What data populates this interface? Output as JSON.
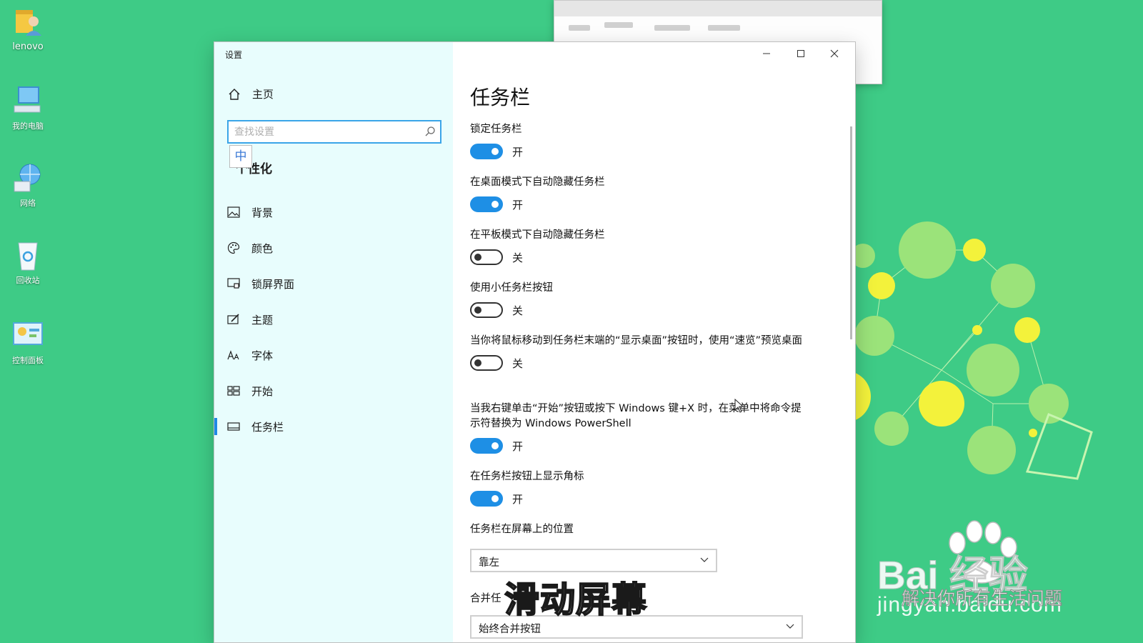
{
  "desktop": {
    "icons": [
      {
        "label": "lenovo",
        "icon": "user-folder-icon"
      },
      {
        "label": "我的电脑",
        "icon": "computer-icon"
      },
      {
        "label": "网络",
        "icon": "network-globe-icon"
      },
      {
        "label": "回收站",
        "icon": "recycle-bin-icon"
      },
      {
        "label": "控制面板",
        "icon": "control-panel-icon"
      }
    ],
    "background_color": "#3ecb86"
  },
  "window": {
    "title": "设置",
    "controls": {
      "minimize": "minimize-icon",
      "maximize": "maximize-icon",
      "close": "close-icon"
    }
  },
  "nav": {
    "home": "主页",
    "search": {
      "placeholder": "查找设置"
    },
    "ime_indicator": "中",
    "section_title": "个性化",
    "items": [
      {
        "label": "背景",
        "icon": "picture-icon"
      },
      {
        "label": "颜色",
        "icon": "palette-icon"
      },
      {
        "label": "锁屏界面",
        "icon": "lock-screen-icon"
      },
      {
        "label": "主题",
        "icon": "theme-brush-icon"
      },
      {
        "label": "字体",
        "icon": "font-icon"
      },
      {
        "label": "开始",
        "icon": "start-menu-icon"
      },
      {
        "label": "任务栏",
        "icon": "taskbar-icon",
        "active": true
      }
    ],
    "accent_color": "#1e88e5"
  },
  "main": {
    "title": "任务栏",
    "settings": [
      {
        "label": "锁定任务栏",
        "state": "开",
        "on": true
      },
      {
        "label": "在桌面模式下自动隐藏任务栏",
        "state": "开",
        "on": true
      },
      {
        "label": "在平板模式下自动隐藏任务栏",
        "state": "关",
        "on": false
      },
      {
        "label": "使用小任务栏按钮",
        "state": "关",
        "on": false
      },
      {
        "label": "当你将鼠标移动到任务栏末端的“显示桌面”按钮时，使用“速览”预览桌面",
        "state": "关",
        "on": false
      },
      {
        "label": "当我右键单击“开始”按钮或按下 Windows 键+X 时，在菜单中将命令提示符替换为 Windows PowerShell",
        "state": "开",
        "on": true
      },
      {
        "label": "在任务栏按钮上显示角标",
        "state": "开",
        "on": true
      }
    ],
    "position": {
      "label": "任务栏在屏幕上的位置",
      "value": "靠左"
    },
    "combine": {
      "label": "合并任",
      "value": "始终合并按钮"
    },
    "toggle_on_color": "#1e8fe5"
  },
  "overlay": {
    "caption": "滑动屏幕",
    "watermark_logo": "Bai 经验",
    "watermark_url": "jingyan.baidu.com",
    "watermark_slogan": "解决你所有生活问题"
  }
}
